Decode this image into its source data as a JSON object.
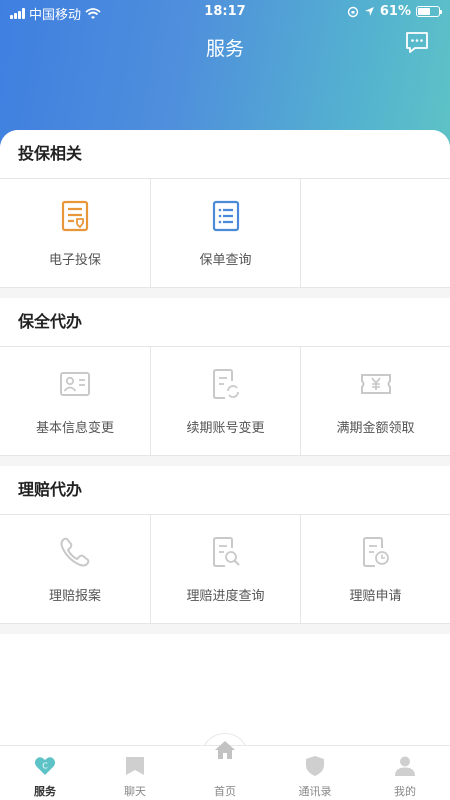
{
  "status": {
    "carrier": "中国移动",
    "time": "18:17",
    "battery": "61%",
    "battery_level": 0.61
  },
  "header": {
    "title": "服务"
  },
  "sections": [
    {
      "title": "投保相关",
      "items": [
        {
          "label": "电子投保",
          "icon": "insurance-form-icon"
        },
        {
          "label": "保单查询",
          "icon": "policy-list-icon"
        }
      ]
    },
    {
      "title": "保全代办",
      "items": [
        {
          "label": "基本信息变更",
          "icon": "id-card-icon"
        },
        {
          "label": "续期账号变更",
          "icon": "renew-account-icon"
        },
        {
          "label": "满期金额领取",
          "icon": "yen-ticket-icon"
        }
      ]
    },
    {
      "title": "理赔代办",
      "items": [
        {
          "label": "理赔报案",
          "icon": "phone-icon"
        },
        {
          "label": "理赔进度查询",
          "icon": "search-document-icon"
        },
        {
          "label": "理赔申请",
          "icon": "document-clock-icon"
        }
      ]
    }
  ],
  "tabbar": {
    "items": [
      {
        "label": "服务",
        "icon": "heart-c-icon",
        "active": true
      },
      {
        "label": "聊天",
        "icon": "bookmark-icon"
      },
      {
        "label": "首页",
        "icon": "home-icon"
      },
      {
        "label": "通讯录",
        "icon": "shield-icon"
      },
      {
        "label": "我的",
        "icon": "person-icon"
      }
    ]
  },
  "colors": {
    "accent_orange": "#e8963a",
    "accent_blue": "#4a8ad8",
    "disabled_gray": "#c9c9c9",
    "tab_teal": "#5ec3c6"
  }
}
